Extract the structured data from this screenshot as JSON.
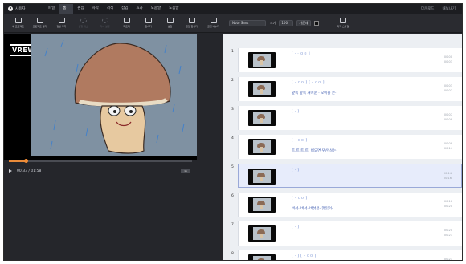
{
  "menubar": {
    "user": "사용자",
    "items": [
      "파일",
      "홈",
      "편집",
      "자막",
      "서식",
      "삽입",
      "효과",
      "도움말",
      "도움말"
    ],
    "right": [
      "다운로드",
      "내보내기"
    ]
  },
  "toolbar": {
    "tools": [
      {
        "name": "new-project",
        "label": "새 프로젝트"
      },
      {
        "name": "open-project",
        "label": "프로젝트 열기"
      },
      {
        "name": "add-video",
        "label": "영상 추가"
      },
      {
        "name": "undo",
        "label": "실행 취소",
        "disabled": true
      },
      {
        "name": "redo",
        "label": "다시 실행",
        "disabled": true
      },
      {
        "name": "split",
        "label": "자르기"
      },
      {
        "name": "merge",
        "label": "합치기"
      },
      {
        "name": "insert",
        "label": "삽입"
      },
      {
        "name": "layout-1",
        "label": "클립 합치기"
      },
      {
        "name": "layout-2",
        "label": "클립 나누기"
      }
    ],
    "font": "Noto Sans",
    "size_label": "크기",
    "size": "100",
    "align": "가운데",
    "color": "#111111",
    "caption_tool": "자막 스타일"
  },
  "preview": {
    "logo": "VREW",
    "time": "00:33 / 01:58",
    "chip": "1x",
    "progress": 0.09
  },
  "clips": [
    {
      "num": "1",
      "tags": "[ · · ㅁㅁ ]",
      "text": "",
      "t1": "00:00",
      "t2": "00:03",
      "selected": false
    },
    {
      "num": "2",
      "tags": "[ · ㅁㅁ ] [ · ㅁㅁ ]",
      "text": "앞쪽 앞쪽 개어운 · 오이콜 은·",
      "t1": "00:03",
      "t2": "00:07",
      "selected": false
    },
    {
      "num": "3",
      "tags": "[ · ]",
      "text": "",
      "t1": "00:07",
      "t2": "00:09",
      "selected": false
    },
    {
      "num": "4",
      "tags": "[ · ㅁㅁ ]",
      "text": "트,트,트,트, 비오면 우산 쓰는·",
      "t1": "00:09",
      "t2": "00:14",
      "selected": false
    },
    {
      "num": "5",
      "tags": "[ · ]",
      "text": "",
      "t1": "00:14",
      "t2": "00:16",
      "selected": true
    },
    {
      "num": "6",
      "tags": "[ · ㅁㅁ ]",
      "text": "버섯· 버섯· 버섯은· 멋있어·",
      "t1": "00:16",
      "t2": "00:20",
      "selected": false
    },
    {
      "num": "7",
      "tags": "[ · ]",
      "text": "",
      "t1": "00:20",
      "t2": "00:23",
      "selected": false
    },
    {
      "num": "8",
      "tags": "[ · ] [ · ㅁㅁ ]",
      "text": "",
      "t1": "00:23",
      "t2": "00:26",
      "selected": false
    }
  ]
}
